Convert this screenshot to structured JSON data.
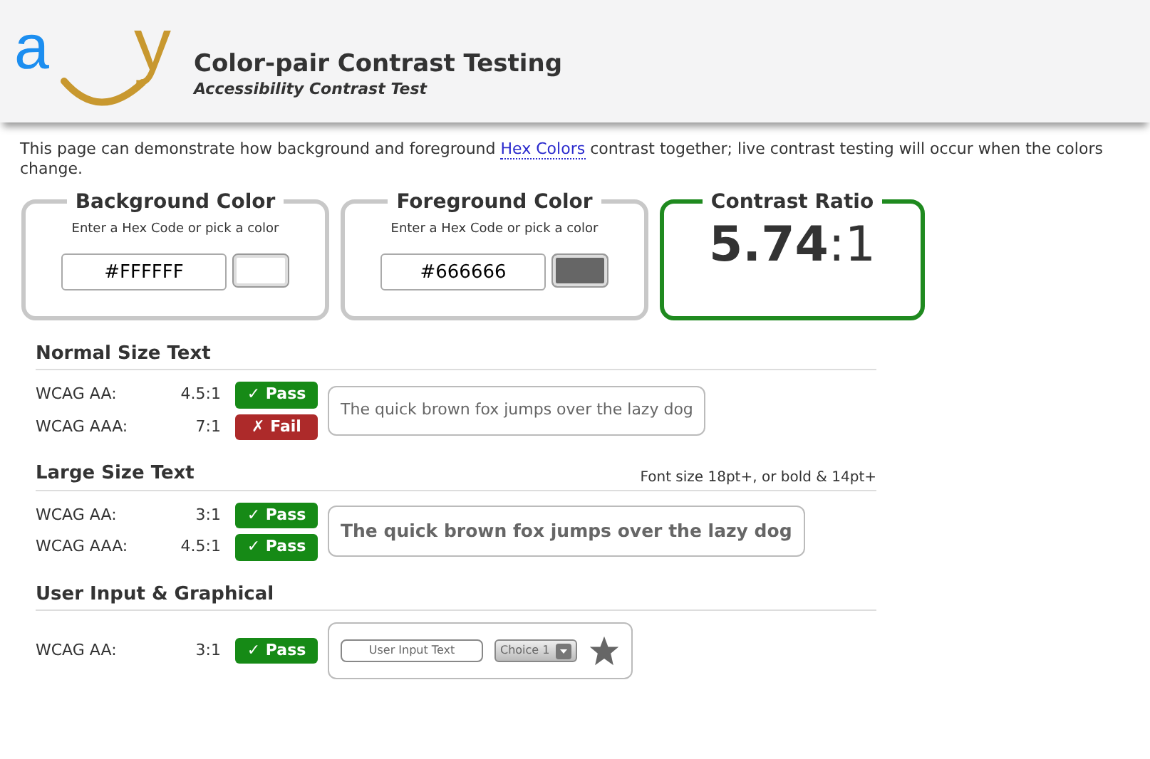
{
  "header": {
    "logo_letters": [
      "a",
      "y"
    ],
    "title": "Color-pair Contrast Testing",
    "subtitle": "Accessibility Contrast Test"
  },
  "intro": {
    "before": "This page can demonstrate how background and foreground ",
    "link": "Hex Colors",
    "after": " contrast together; live contrast testing will occur when the colors change."
  },
  "color_inputs": [
    {
      "legend": "Background Color",
      "hint": "Enter a Hex Code or pick a color",
      "value": "#FFFFFF",
      "color": "#ffffff"
    },
    {
      "legend": "Foreground Color",
      "hint": "Enter a Hex Code or pick a color",
      "value": "#666666",
      "color": "#666666"
    }
  ],
  "contrast": {
    "legend": "Contrast Ratio",
    "ratio": "**5.74**:1"
  },
  "sections": [
    {
      "title": "Normal Size Text",
      "kind": "normal",
      "rows": [
        {
          "label": "WCAG AA:",
          "ratio": "4.5:1",
          "result": "✓ Pass",
          "passed": true
        },
        {
          "label": "WCAG AAA:",
          "ratio": "7:1",
          "result": "✗ Fail",
          "passed": false
        }
      ],
      "sample": "The quick brown fox jumps over the lazy dog"
    },
    {
      "title": "Large Size Text",
      "note": "Font size 18pt+, or bold & 14pt+",
      "kind": "large",
      "rows": [
        {
          "label": "WCAG AA:",
          "ratio": "3:1",
          "result": "✓ Pass",
          "passed": true
        },
        {
          "label": "WCAG AAA:",
          "ratio": "4.5:1",
          "result": "✓ Pass",
          "passed": true
        }
      ],
      "sample": "The quick brown fox jumps over the lazy dog"
    },
    {
      "title": "User Input & Graphical",
      "kind": "controls",
      "rows": [
        {
          "label": "WCAG AA:",
          "ratio": "3:1",
          "result": "✓ Pass",
          "passed": true
        }
      ],
      "input_value": "User Input Text",
      "select_value": "Choice 1"
    }
  ]
}
